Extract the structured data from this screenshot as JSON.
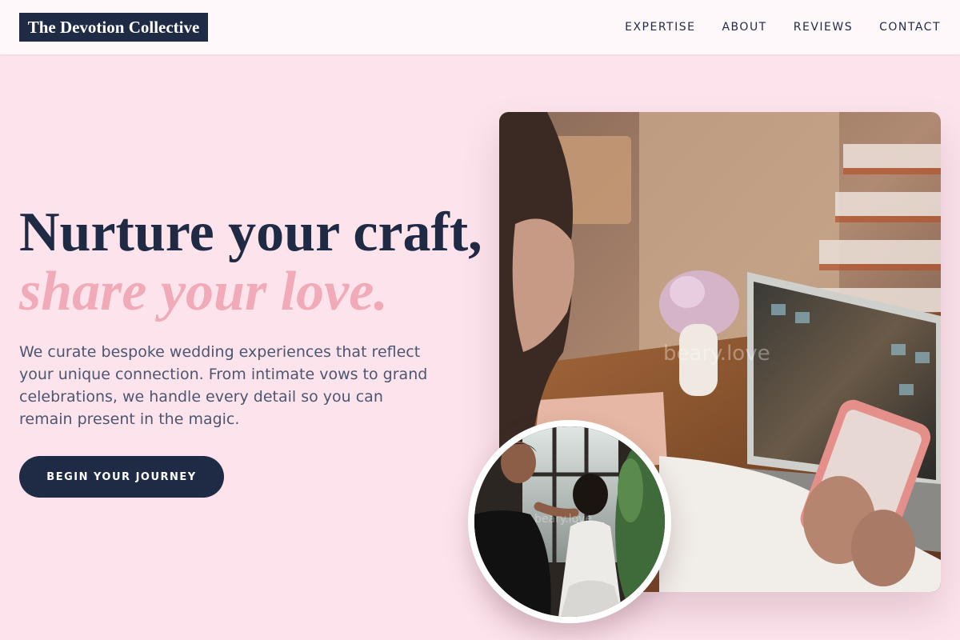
{
  "brand": {
    "name": "The Devotion Collective"
  },
  "nav": {
    "items": [
      "EXPERTISE",
      "ABOUT",
      "REVIEWS",
      "CONTACT"
    ]
  },
  "hero": {
    "title_line1": "Nurture your craft,",
    "title_line2": "share your love.",
    "description": "We curate bespoke wedding experiences that reflect your unique connection. From intimate vows to grand celebrations, we handle every detail so you can remain present in the magic.",
    "cta_label": "BEGIN YOUR JOURNEY"
  },
  "images": {
    "main_watermark": "beary.love",
    "circle_watermark": "beary.love"
  },
  "colors": {
    "background": "#fde4ec",
    "header_bg": "#fff8fa",
    "navy": "#1f2a44",
    "accent_pink": "#f0aab8",
    "body_text": "#4c5670"
  }
}
